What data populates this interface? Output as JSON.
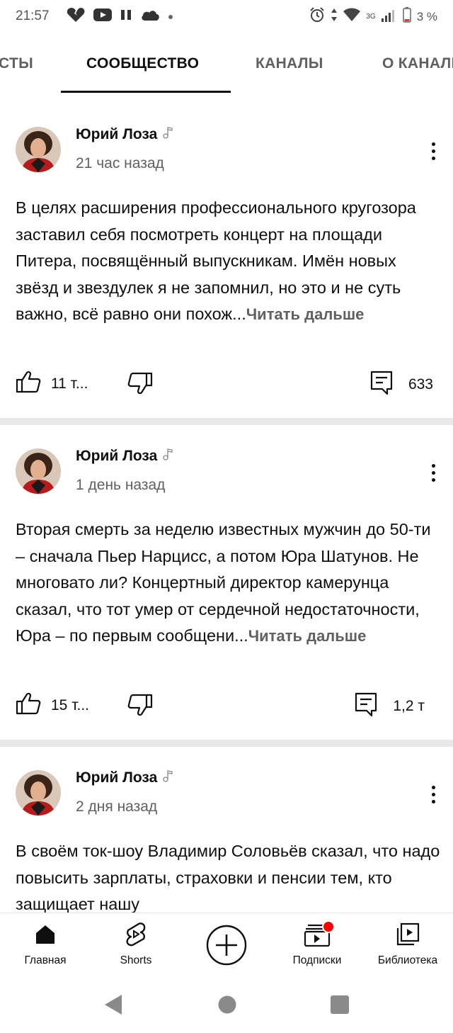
{
  "status_bar": {
    "time": "21:57",
    "battery": "3 %",
    "network": "3G",
    "icons": [
      "broken-heart-icon",
      "youtube-icon",
      "pause-icon",
      "cloud-icon",
      "alarm-icon",
      "data-arrows-icon",
      "wifi-icon",
      "signal-icon",
      "battery-icon"
    ]
  },
  "tabs": [
    {
      "label": "СТЫ",
      "active": false
    },
    {
      "label": "СООБЩЕСТВО",
      "active": true
    },
    {
      "label": "КАНАЛЫ",
      "active": false
    },
    {
      "label": "О КАНАЛЕ",
      "active": false
    }
  ],
  "posts": [
    {
      "author": "Юрий Лоза",
      "time": "21 час назад",
      "text": "В целях расширения профессионального кругозора заставил себя посмотреть концерт на площади Питера, посвящённый выпускникам. Имён новых звёзд и звездулек я не запомнил, но это и не суть важно, всё равно они похож...",
      "read_more": "Читать дальше",
      "likes": "11 т...",
      "comments": "633"
    },
    {
      "author": "Юрий Лоза",
      "time": "1 день назад",
      "text": "Вторая смерть за неделю известных мужчин до 50-ти – сначала Пьер Нарцисс, а потом Юра Шатунов. Не многовато ли? Концертный директор камерунца сказал, что тот умер от сердечной недостаточности, Юра – по первым сообщени...",
      "read_more": "Читать дальше",
      "likes": "15 т...",
      "comments": "1,2 т"
    },
    {
      "author": "Юрий Лоза",
      "time": "2 дня назад",
      "text": "В своём ток-шоу Владимир Соловьёв сказал, что надо повысить зарплаты, страховки и пенсии тем, кто защищает нашу"
    }
  ],
  "bottom_nav": [
    {
      "label": "Главная",
      "icon": "home-icon"
    },
    {
      "label": "Shorts",
      "icon": "shorts-icon"
    },
    {
      "label": "",
      "icon": "create-icon"
    },
    {
      "label": "Подписки",
      "icon": "subscriptions-icon"
    },
    {
      "label": "Библиотека",
      "icon": "library-icon"
    }
  ],
  "colors": {
    "text": "#0f0f0f",
    "secondary": "#606060",
    "divider": "#e8e8e8",
    "notification": "#ff0000"
  }
}
